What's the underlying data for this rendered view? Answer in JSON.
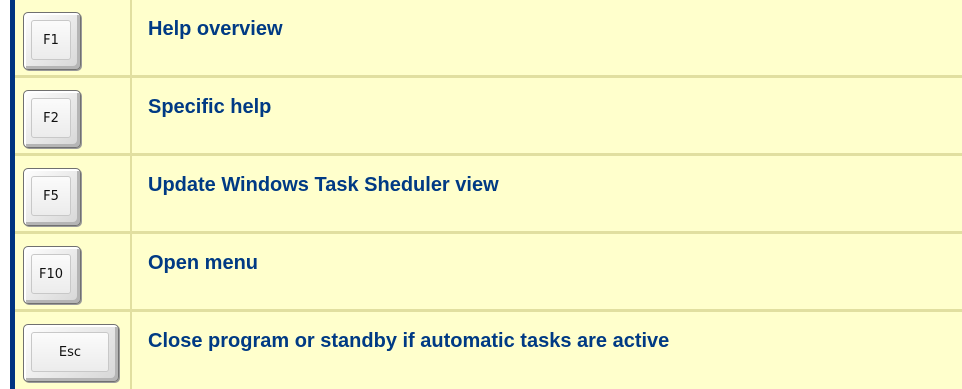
{
  "shortcuts": [
    {
      "key": "F1",
      "description": "Help overview"
    },
    {
      "key": "F2",
      "description": "Specific help"
    },
    {
      "key": "F5",
      "description": "Update Windows Task Sheduler view"
    },
    {
      "key": "F10",
      "description": "Open menu"
    },
    {
      "key": "Esc",
      "description": "Close program or standby if automatic tasks are active"
    }
  ],
  "colors": {
    "background": "#ffffcc",
    "text": "#003a84",
    "left_border": "#003380",
    "row_divider": "#e1dfa0"
  }
}
